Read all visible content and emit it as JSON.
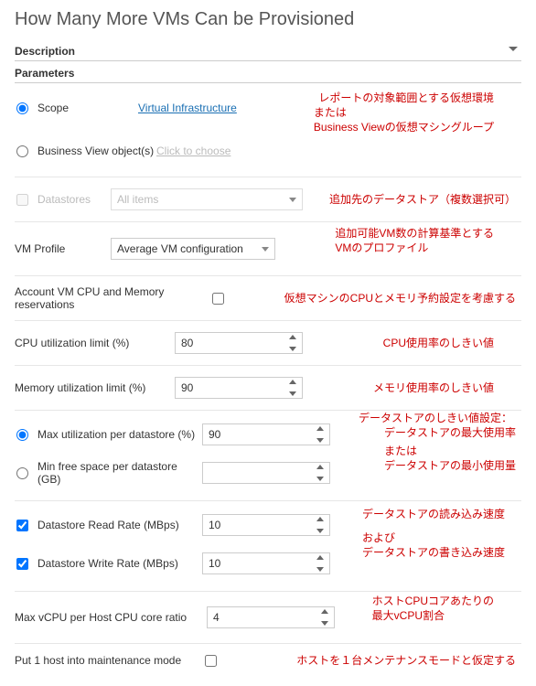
{
  "title": "How Many More VMs Can be Provisioned",
  "sections": {
    "description": "Description",
    "parameters": "Parameters"
  },
  "rows": {
    "scope": {
      "label": "Scope",
      "link": "Virtual Infrastructure"
    },
    "bvo": {
      "label": "Business View object(s)",
      "link": "Click to choose"
    },
    "ds": {
      "label": "Datastores",
      "value": "All items"
    },
    "vmprof": {
      "label": "VM Profile",
      "value": "Average VM configuration"
    },
    "reserv": {
      "label": "Account VM CPU and Memory reservations"
    },
    "cpu": {
      "label": "CPU utilization limit (%)",
      "value": "80"
    },
    "mem": {
      "label": "Memory utilization limit (%)",
      "value": "90"
    },
    "maxds": {
      "label": "Max utilization per datastore (%)",
      "value": "90"
    },
    "minds": {
      "label": "Min free space per datastore (GB)",
      "value": ""
    },
    "read": {
      "label": "Datastore Read Rate (MBps)",
      "value": "10"
    },
    "write": {
      "label": "Datastore Write Rate (MBps)",
      "value": "10"
    },
    "vcpu": {
      "label": "Max vCPU per Host CPU core ratio",
      "value": "4"
    },
    "maint": {
      "label": "Put 1 host into maintenance mode"
    }
  },
  "notes": {
    "scope1": "レポートの対象範囲とする仮想環境",
    "scope2": "または",
    "scope3": "Business Viewの仮想マシングループ",
    "ds": "追加先のデータストア（複数選択可）",
    "vmprof1": "追加可能VM数の計算基準とする",
    "vmprof2": "VMのプロファイル",
    "reserv": "仮想マシンのCPUとメモリ予約設定を考慮する",
    "cpu": "CPU使用率のしきい値",
    "mem": "メモリ使用率のしきい値",
    "ds_t": "データストアのしきい値設定：",
    "ds_a": "データストアの最大使用率",
    "ds_o": "または",
    "ds_b": "データストアの最小使用量",
    "read": "データストアの読み込み速度",
    "rw_o": "および",
    "write": "データストアの書き込み速度",
    "vcpu1": "ホストCPUコアあたりの",
    "vcpu2": "最大vCPU割合",
    "maint": "ホストを１台メンテナンスモードと仮定する"
  }
}
